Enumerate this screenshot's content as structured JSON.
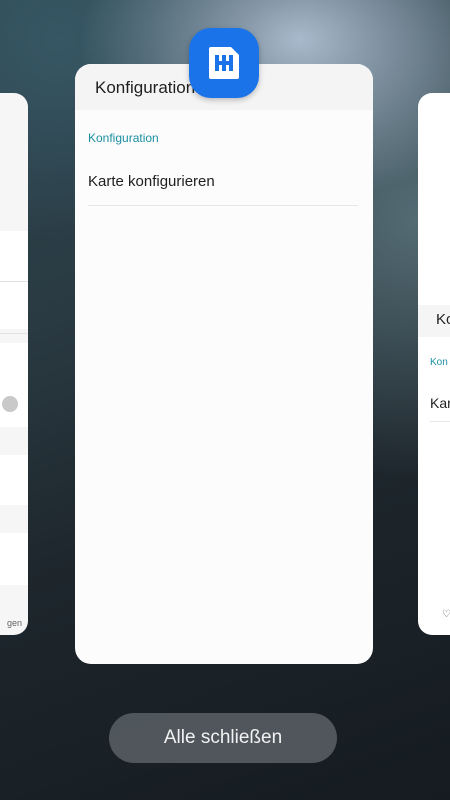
{
  "recents": {
    "center_card": {
      "app_title": "Konfiguration",
      "section_header": "Konfiguration",
      "items": [
        {
          "label": "Karte konfigurieren"
        }
      ]
    },
    "right_card": {
      "title_partial": "Ko",
      "section_partial": "Kon",
      "item_partial": "Kar"
    },
    "left_card": {
      "label_partial": "gen"
    },
    "close_all_label": "Alle schließen"
  },
  "colors": {
    "accent": "#1c8fa0",
    "app_icon": "#1a73e8"
  },
  "icons": {
    "app_icon": "sim-card-icon"
  }
}
